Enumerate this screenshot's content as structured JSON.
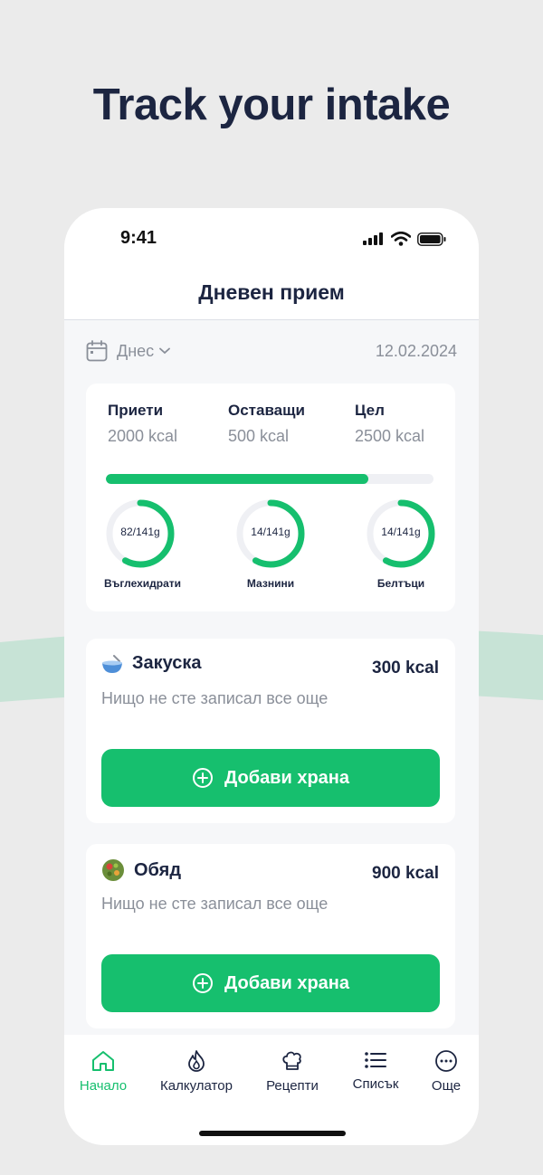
{
  "headline": "Track your intake",
  "colors": {
    "accent": "#16bf6e",
    "text": "#1c2541",
    "muted": "#8a8f99",
    "wave": "#c7e3d6"
  },
  "status": {
    "time": "9:41"
  },
  "screen": {
    "title": "Дневен прием"
  },
  "date": {
    "label": "Днес",
    "value": "12.02.2024"
  },
  "summary": {
    "eaten_label": "Приети",
    "eaten_value": "2000 kcal",
    "remaining_label": "Оставащи",
    "remaining_value": "500 kcal",
    "goal_label": "Цел",
    "goal_value": "2500 kcal",
    "progress": 0.8
  },
  "macros": [
    {
      "value": "82/141g",
      "label": "Въглехидрати",
      "fraction": 0.58
    },
    {
      "value": "14/141g",
      "label": "Мазнини",
      "fraction": 0.58
    },
    {
      "value": "14/141g",
      "label": "Белтъци",
      "fraction": 0.58
    }
  ],
  "meals": [
    {
      "name": "Закуска",
      "kcal": "300 kcal",
      "empty": "Нищо не сте записал все още",
      "button": "Добави храна",
      "icon": "bowl-icon"
    },
    {
      "name": "Обяд",
      "kcal": "900 kcal",
      "empty": "Нищо не сте записал все още",
      "button": "Добави храна",
      "icon": "salad-icon"
    }
  ],
  "tabs": [
    {
      "label": "Начало",
      "icon": "home-icon",
      "active": true
    },
    {
      "label": "Калкулатор",
      "icon": "flame-icon",
      "active": false
    },
    {
      "label": "Рецепти",
      "icon": "chef-hat-icon",
      "active": false
    },
    {
      "label": "Списък",
      "icon": "list-icon",
      "active": false
    },
    {
      "label": "Още",
      "icon": "more-icon",
      "active": false
    }
  ]
}
